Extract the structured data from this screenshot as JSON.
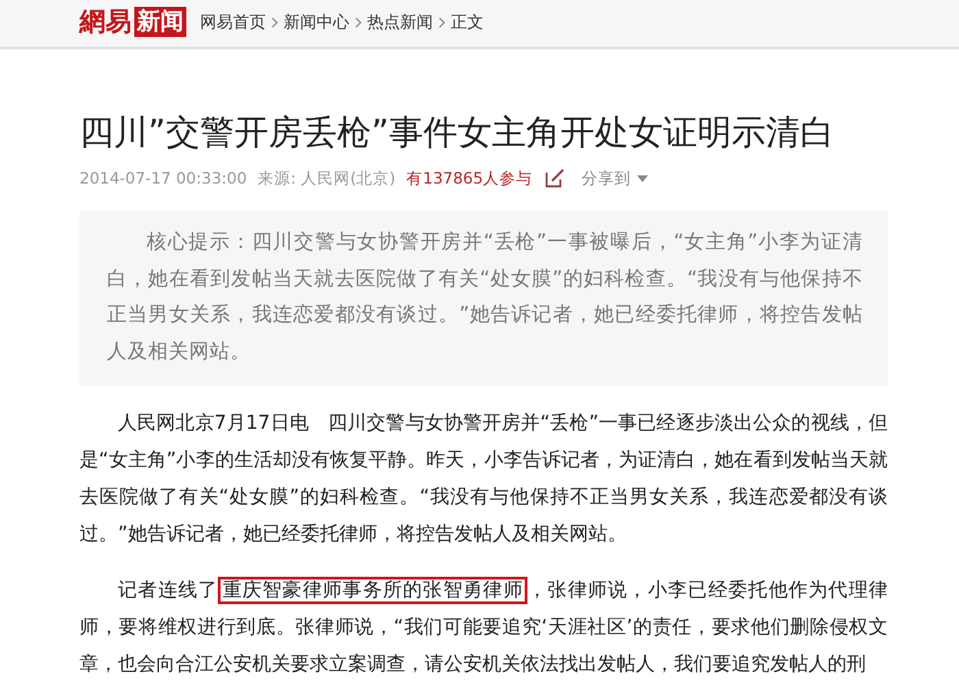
{
  "header": {
    "logo": {
      "part_1": "網易",
      "part_2": "新闻"
    },
    "breadcrumbs": [
      "网易首页",
      "新闻中心",
      "热点新闻",
      "正文"
    ]
  },
  "article": {
    "title": "四川”交警开房丢枪”事件女主角开处女证明示清白",
    "meta": {
      "time": "2014-07-17 00:33:00",
      "source": "来源: 人民网(北京)",
      "participants": "有137865人参与",
      "share": "分享到"
    },
    "summary": "核心提示：四川交警与女协警开房并“丢枪”一事被曝后，“女主角”小李为证清白，她在看到发帖当天就去医院做了有关“处女膜”的妇科检查。“我没有与他保持不正当男女关系，我连恋爱都没有谈过。”她告诉记者，她已经委托律师，将控告发帖人及相关网站。",
    "paragraphs": [
      {
        "before": "人民网北京7月17日电　四川交警与女协警开房并“丢枪”一事已经逐步淡出公众的视线，但是“女主角”小李的生活却没有恢复平静。昨天，小李告诉记者，为证清白，她在看到发帖当天就去医院做了有关“处女膜”的妇科检查。“我没有与他保持不正当男女关系，我连恋爱都没有谈过。”她告诉记者，她已经委托律师，将控告发帖人及相关网站。"
      },
      {
        "before": "记者连线了",
        "highlight": "重庆智豪律师事务所的张智勇律师",
        "after": "，张律师说，小李已经委托他作为代理律师，要将维权进行到底。张律师说，“我们可能要追究‘天涯社区’的责任，要求他们删除侵权文章，也会向合江公安机关要求立案调查，请公安机关依法找出发帖人，我们要追究发帖人的刑"
      }
    ]
  }
}
